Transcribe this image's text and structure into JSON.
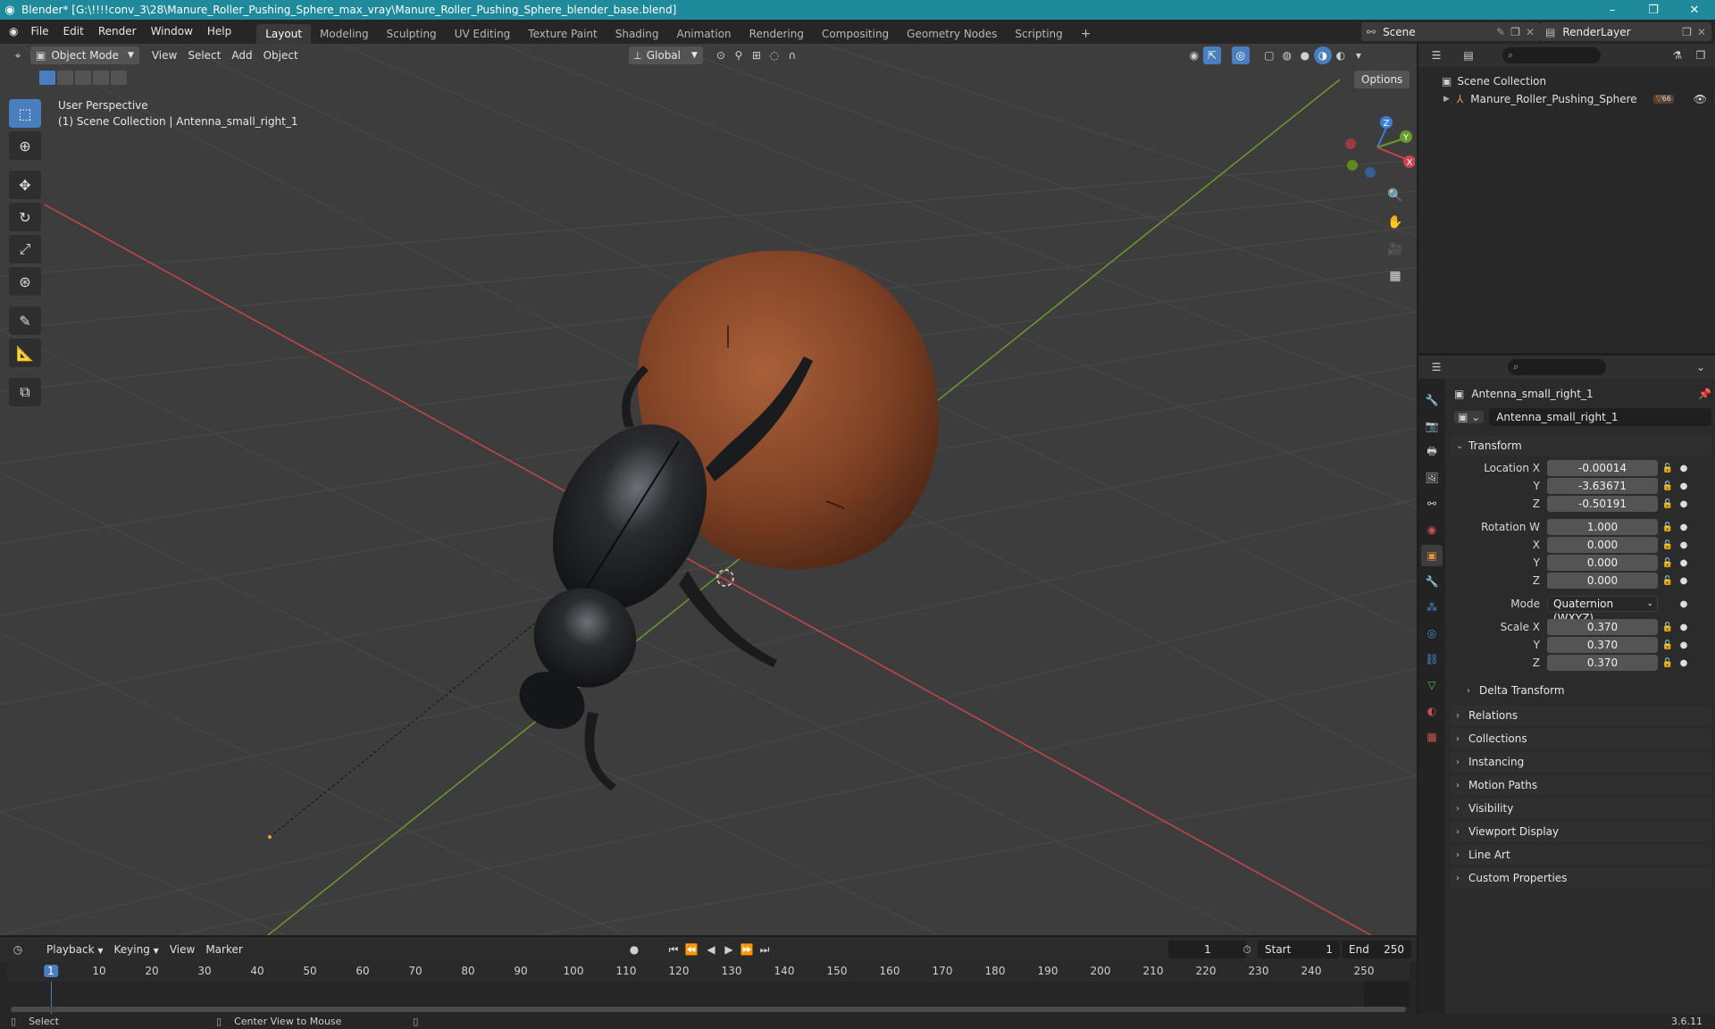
{
  "titlebar": {
    "title": "Blender* [G:\\!!!!conv_3\\28\\Manure_Roller_Pushing_Sphere_max_vray\\Manure_Roller_Pushing_Sphere_blender_base.blend]",
    "minimize": "–",
    "maximize": "❐",
    "close": "✕"
  },
  "menu": [
    "File",
    "Edit",
    "Render",
    "Window",
    "Help"
  ],
  "workspaces": [
    {
      "label": "Layout",
      "active": true
    },
    {
      "label": "Modeling"
    },
    {
      "label": "Sculpting"
    },
    {
      "label": "UV Editing"
    },
    {
      "label": "Texture Paint"
    },
    {
      "label": "Shading"
    },
    {
      "label": "Animation"
    },
    {
      "label": "Rendering"
    },
    {
      "label": "Compositing"
    },
    {
      "label": "Geometry Nodes"
    },
    {
      "label": "Scripting"
    }
  ],
  "add_workspace": "+",
  "scene_selector": {
    "value": "Scene"
  },
  "view_layer_selector": {
    "value": "RenderLayer"
  },
  "viewport": {
    "mode": "Object Mode",
    "menus": [
      "View",
      "Select",
      "Add",
      "Object"
    ],
    "orientation": "Global",
    "options_label": "Options",
    "overlay_line1": "User Perspective",
    "overlay_line2": "(1) Scene Collection | Antenna_small_right_1",
    "gizmo": {
      "x": "X",
      "y": "Y",
      "z": "Z"
    },
    "colors": {
      "x_axis": "#c8454b",
      "y_axis": "#6a9b2a",
      "z_axis": "#3b7fd9",
      "sphere": "#8a4a2a",
      "beetle": "#1e2022"
    }
  },
  "outliner": {
    "root": "Scene Collection",
    "items": [
      {
        "label": "Manure_Roller_Pushing_Sphere",
        "badge": "66"
      }
    ]
  },
  "properties": {
    "object_name": "Antenna_small_right_1",
    "data_name": "Antenna_small_right_1",
    "transform_label": "Transform",
    "location": {
      "label": "Location X",
      "x": "-0.00014",
      "y": "-3.63671",
      "z": "-0.50191"
    },
    "rotation": {
      "label": "Rotation W",
      "w": "1.000",
      "x": "0.000",
      "y": "0.000",
      "z": "0.000"
    },
    "mode": {
      "label": "Mode",
      "value": "Quaternion (WXYZ)"
    },
    "scale": {
      "label": "Scale X",
      "x": "0.370",
      "y": "0.370",
      "z": "0.370"
    },
    "axis_labels": {
      "y": "Y",
      "z": "Z",
      "x": "X"
    },
    "delta_transform": "Delta Transform",
    "panels": [
      "Relations",
      "Collections",
      "Instancing",
      "Motion Paths",
      "Visibility",
      "Viewport Display",
      "Line Art",
      "Custom Properties"
    ]
  },
  "timeline": {
    "menus": [
      "Playback",
      "Keying",
      "View",
      "Marker"
    ],
    "current_frame": "1",
    "start_label": "Start",
    "start": "1",
    "end_label": "End",
    "end": "250",
    "ticks": [
      "1",
      "10",
      "20",
      "30",
      "40",
      "50",
      "60",
      "70",
      "80",
      "90",
      "100",
      "110",
      "120",
      "130",
      "140",
      "150",
      "160",
      "170",
      "180",
      "190",
      "200",
      "210",
      "220",
      "230",
      "240",
      "250"
    ]
  },
  "statusbar": {
    "select": "Select",
    "center_view": "Center View to Mouse",
    "version": "3.6.11"
  }
}
